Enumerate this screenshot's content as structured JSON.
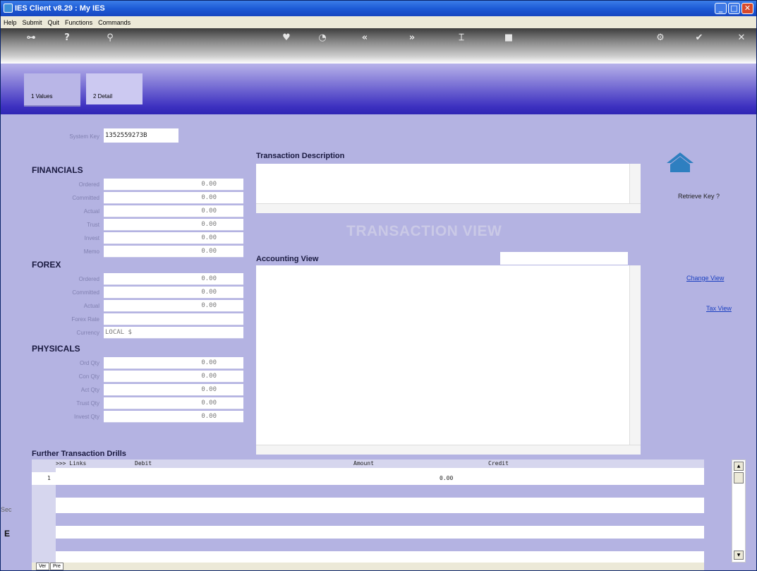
{
  "window": {
    "title": "IES Client v8.29 : My IES",
    "min": "_",
    "max": "□",
    "close": "✕"
  },
  "menu": [
    "Help",
    "Submit",
    "Quit",
    "Functions",
    "Commands"
  ],
  "toolbar": {
    "key": "⊶",
    "help": "?",
    "search": "⚲",
    "fav": "♥",
    "clock": "◔",
    "first": "«",
    "last": "»",
    "mark": "⌶",
    "block": "■",
    "settings": "⚙",
    "ok": "✔",
    "close": "✕"
  },
  "tabs": [
    {
      "label": "1 Values"
    },
    {
      "label": "2 Detail"
    }
  ],
  "system_key": {
    "label": "System Key",
    "value": "1352559273B"
  },
  "financials": {
    "title": "FINANCIALS",
    "rows": [
      {
        "label": "Ordered",
        "value": "0.00"
      },
      {
        "label": "Committed",
        "value": "0.00"
      },
      {
        "label": "Actual",
        "value": "0.00"
      },
      {
        "label": "Trust",
        "value": "0.00"
      },
      {
        "label": "Invest",
        "value": "0.00"
      },
      {
        "label": "Memo",
        "value": "0.00"
      }
    ]
  },
  "forex": {
    "title": "FOREX",
    "rows": [
      {
        "label": "Ordered",
        "value": "0.00"
      },
      {
        "label": "Committed",
        "value": "0.00"
      },
      {
        "label": "Actual",
        "value": "0.00"
      },
      {
        "label": "Forex Rate",
        "value": ""
      },
      {
        "label": "Currency",
        "value": "LOCAL $"
      }
    ]
  },
  "physicals": {
    "title": "PHYSICALS",
    "rows": [
      {
        "label": "Ord Qty",
        "value": "0.00"
      },
      {
        "label": "Con Qty",
        "value": "0.00"
      },
      {
        "label": "Act Qty",
        "value": "0.00"
      },
      {
        "label": "Trust Qty",
        "value": "0.00"
      },
      {
        "label": "Invest Qty",
        "value": "0.00"
      }
    ]
  },
  "transaction_description": {
    "label": "Transaction Description"
  },
  "transaction_view": "TRANSACTION VIEW",
  "accounting_view": {
    "label": "Accounting View"
  },
  "retrieve_key": "Retrieve Key ?",
  "change_view": "Change View",
  "tax_view": "Tax View",
  "drills": {
    "title": "Further Transaction Drills",
    "columns": {
      "links": ">>> Links",
      "debit": "Debit",
      "amount": "Amount",
      "credit": "Credit"
    },
    "rows": [
      {
        "num": "1",
        "amount": "0.00"
      }
    ]
  },
  "bottom_tabs": [
    "Ver",
    "Pre"
  ],
  "side": {
    "sec": "Sec",
    "e": "E"
  }
}
